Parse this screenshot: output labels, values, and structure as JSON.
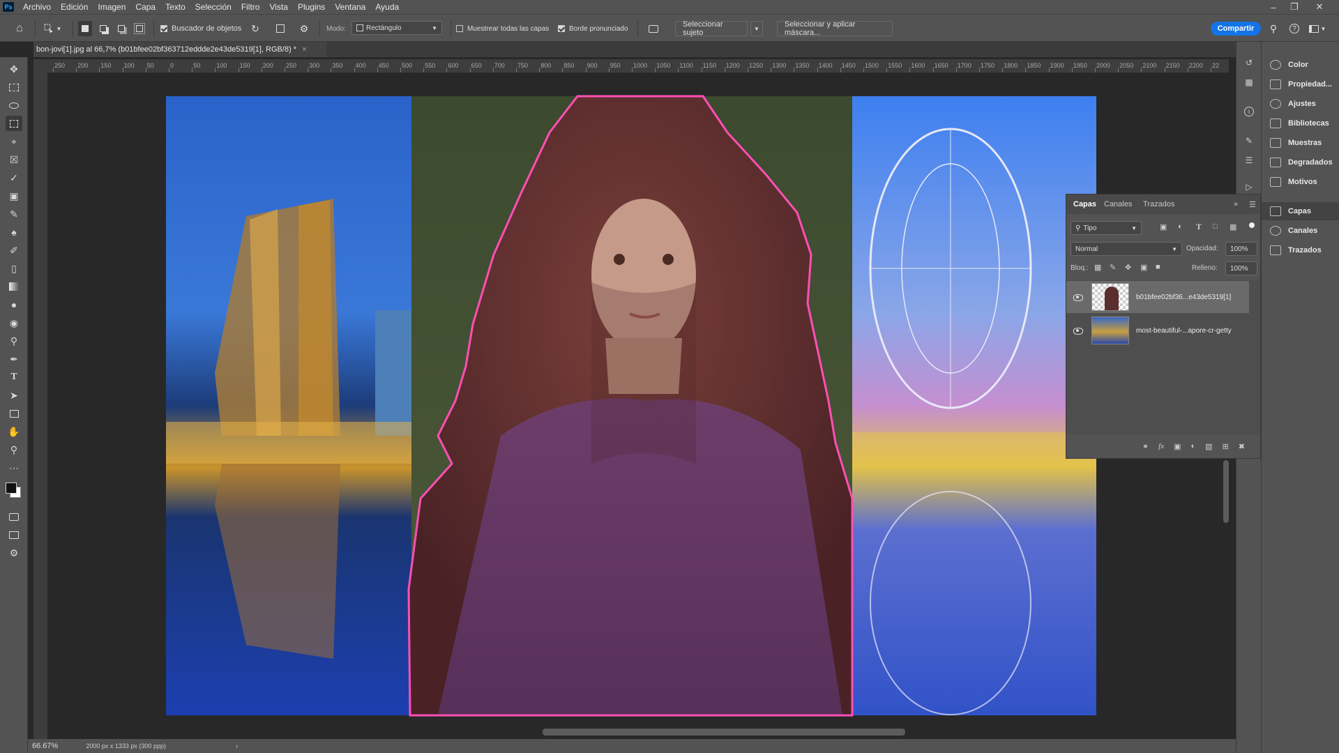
{
  "menu": {
    "items": [
      "Archivo",
      "Edición",
      "Imagen",
      "Capa",
      "Texto",
      "Selección",
      "Filtro",
      "Vista",
      "Plugins",
      "Ventana",
      "Ayuda"
    ]
  },
  "options": {
    "object_finder": "Buscador de objetos",
    "mode_label": "Modo:",
    "mode_value": "Rectángulo",
    "sample_all_layers": "Muestrear todas las capas",
    "hard_edge": "Borde pronunciado",
    "select_subject": "Seleccionar sujeto",
    "select_and_mask": "Seleccionar y aplicar máscara...",
    "share": "Compartir",
    "object_finder_checked": true,
    "sample_all_checked": false,
    "hard_edge_checked": true
  },
  "document": {
    "tab_title": "bon-jovi[1].jpg al 66,7% (b01bfee02bf363712eddde2e43de5319[1], RGB/8) *"
  },
  "ruler": {
    "ticks": [
      "250",
      "200",
      "150",
      "100",
      "50",
      "0",
      "50",
      "100",
      "150",
      "200",
      "250",
      "300",
      "350",
      "400",
      "450",
      "500",
      "550",
      "600",
      "650",
      "700",
      "750",
      "800",
      "850",
      "900",
      "950",
      "1000",
      "1050",
      "1100",
      "1150",
      "1200",
      "1250",
      "1300",
      "1350",
      "1400",
      "1450",
      "1500",
      "1550",
      "1600",
      "1650",
      "1700",
      "1750",
      "1800",
      "1850",
      "1900",
      "1950",
      "2000",
      "2050",
      "2100",
      "2150",
      "2200",
      "22"
    ]
  },
  "status": {
    "zoom": "66.67%",
    "doc_info": "2000 px x 1333 px (300 ppp)"
  },
  "layers_panel": {
    "tabs": [
      "Capas",
      "Canales",
      "Trazados"
    ],
    "filter": "Tipo",
    "blend_mode": "Normal",
    "opacity_label": "Opacidad:",
    "opacity_value": "100%",
    "lock_label": "Bloq.:",
    "fill_label": "Relleno:",
    "fill_value": "100%",
    "layers": [
      {
        "name": "b01bfee02bf36...e43de5319[1]",
        "selected": true
      },
      {
        "name": "most-beautiful-...apore-cr-getty",
        "selected": false
      }
    ]
  },
  "right_dock": {
    "items": [
      "Color",
      "Propiedad...",
      "Ajustes",
      "Bibliotecas",
      "Muestras",
      "Degradados",
      "Motivos"
    ],
    "items2": [
      "Capas",
      "Canales",
      "Trazados"
    ]
  },
  "colors": {
    "accent": "#1473e6",
    "selection_outline": "#ff4fb4"
  }
}
